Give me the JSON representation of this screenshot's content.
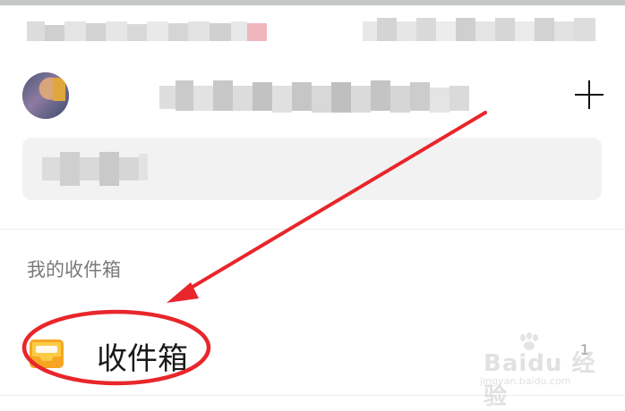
{
  "inbox_section": {
    "title": "我的收件箱",
    "item_label": "收件箱",
    "item_count": "1"
  },
  "watermark": {
    "brand": "Baidu 经验",
    "url": "jingyan.baidu.com"
  },
  "colors": {
    "annotation_red": "#e8262b",
    "inbox_icon_orange": "#f6a623",
    "inbox_icon_yellow": "#fbcb44"
  },
  "icons": {
    "add": "plus-icon",
    "inbox": "inbox-icon",
    "avatar": "user-avatar"
  }
}
